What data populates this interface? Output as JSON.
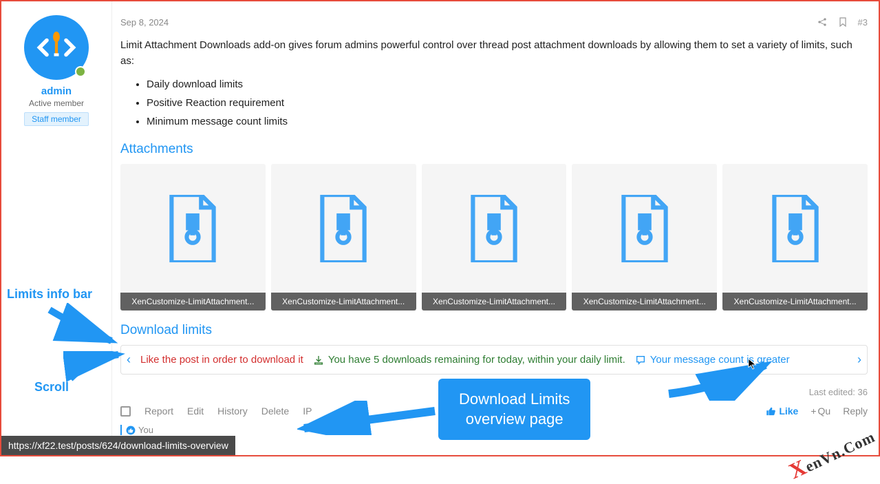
{
  "post": {
    "date": "Sep 8, 2024",
    "number": "#3",
    "intro": "Limit Attachment Downloads add-on gives forum admins powerful control over thread post attachment downloads by allowing them to set a variety of limits, such as:",
    "bullets": [
      "Daily download limits",
      "Positive Reaction requirement",
      "Minimum message count limits"
    ],
    "last_edited": "Last edited: 36 "
  },
  "user": {
    "name": "admin",
    "title": "Active member",
    "badge": "Staff member"
  },
  "sections": {
    "attachments": "Attachments",
    "download_limits": "Download limits"
  },
  "attachments": [
    {
      "name": "XenCustomize-LimitAttachment..."
    },
    {
      "name": "XenCustomize-LimitAttachment..."
    },
    {
      "name": "XenCustomize-LimitAttachment..."
    },
    {
      "name": "XenCustomize-LimitAttachment..."
    },
    {
      "name": "XenCustomize-LimitAttachment..."
    }
  ],
  "limits_bar": {
    "msg_like": "Like the post in order to download it",
    "msg_daily": "You have 5 downloads remaining for today, within your daily limit.",
    "msg_count": "Your message count is greater"
  },
  "actions": {
    "report": "Report",
    "edit": "Edit",
    "history": "History",
    "delete": "Delete",
    "ip": "IP",
    "like": "Like",
    "quote": "Qu",
    "reply": "Reply",
    "you": "You"
  },
  "annotations": {
    "limits_info_bar": "Limits info bar",
    "scroll": "Scroll",
    "callout": "Download Limits overview page"
  },
  "status_url": "https://xf22.test/posts/624/download-limits-overview",
  "watermark": {
    "x": "X",
    "rest": "enVn.Com"
  }
}
